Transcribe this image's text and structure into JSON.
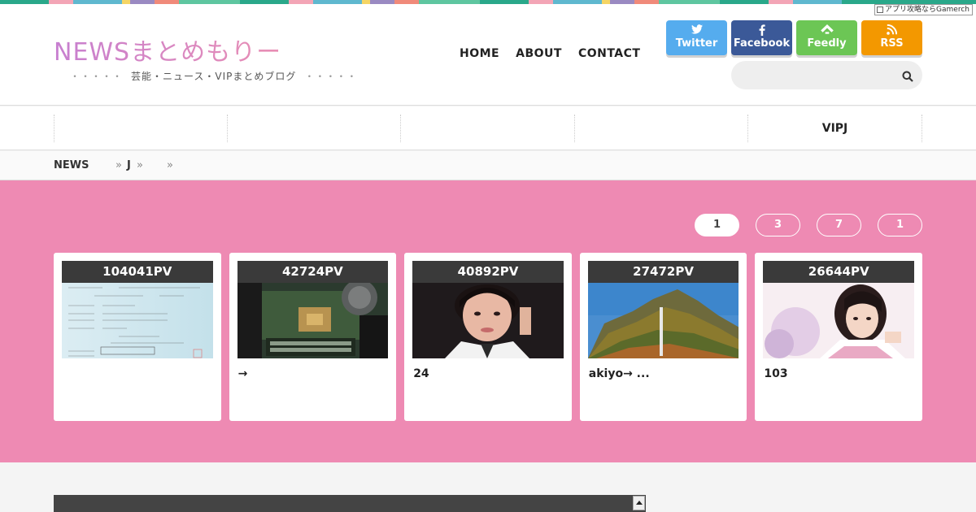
{
  "stripe_colors": [
    "#2aa88a",
    "#f3a5b6",
    "#5fb8cf",
    "#f5d564",
    "#9a8ac2",
    "#f08a7a",
    "#5ec6a0",
    "#2aa88a",
    "#f3a5b6",
    "#5fb8cf",
    "#f5d564",
    "#9a8ac2",
    "#f08a7a",
    "#5ec6a0",
    "#2aa88a",
    "#f3a5b6",
    "#5fb8cf",
    "#f5d564",
    "#9a8ac2",
    "#f08a7a",
    "#5ec6a0",
    "#2aa88a",
    "#f3a5b6",
    "#5fb8cf"
  ],
  "gamerch": "アプリ攻略ならGamerch",
  "site": {
    "logo": "NEWSまとめもりー",
    "tagline_dots_left": "・・・・・",
    "tagline": "芸能・ニュース・VIPまとめブログ",
    "tagline_dots_right": "・・・・・"
  },
  "nav": {
    "home": "HOME",
    "about": "ABOUT",
    "contact": "CONTACT"
  },
  "social": {
    "twitter": {
      "label": "Twitter",
      "color": "#55acee"
    },
    "facebook": {
      "label": "Facebook",
      "color": "#3b5998"
    },
    "feedly": {
      "label": "Feedly",
      "color": "#6cc655"
    },
    "rss": {
      "label": "RSS",
      "color": "#f39800"
    }
  },
  "search": {
    "placeholder": ""
  },
  "categories": [
    "",
    "",
    "",
    "",
    "VIPJ"
  ],
  "breadcrumb": {
    "home": "NEWS",
    "sep": "»",
    "level1": "J"
  },
  "ranking_tabs": [
    "1",
    "3",
    "7",
    "1"
  ],
  "cards": [
    {
      "pv": "104041PV",
      "title": ""
    },
    {
      "pv": "42724PV",
      "title": "→"
    },
    {
      "pv": "40892PV",
      "title": "24"
    },
    {
      "pv": "27472PV",
      "title": "akiyo→ ..."
    },
    {
      "pv": "26644PV",
      "title": "103"
    }
  ],
  "colors": {
    "pink_section": "#ee8ab3"
  }
}
